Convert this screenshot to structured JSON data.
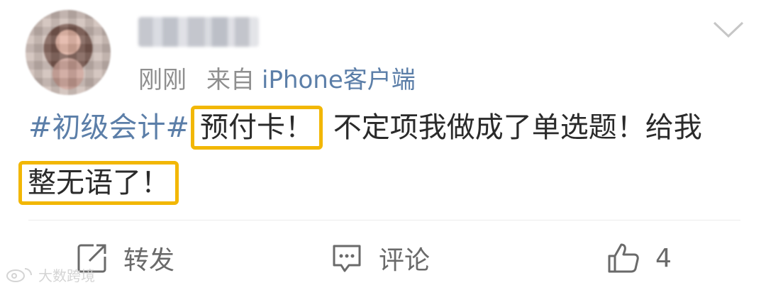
{
  "post": {
    "time": "刚刚",
    "source_prefix": "来自",
    "client": "iPhone客户端",
    "hashtag": "#初级会计#",
    "highlight_1": "预付卡！",
    "text_1": "不定项我做成了单选题！给我",
    "highlight_2": "整无语了！"
  },
  "actions": {
    "repost_label": "转发",
    "comment_label": "评论",
    "like_count": "4"
  },
  "watermark": "大数跨境",
  "icons": {
    "menu": "chevron-down-icon",
    "repost": "repost-icon",
    "comment": "comment-icon",
    "like": "thumbs-up-icon",
    "watermark": "weibo-logo-icon"
  },
  "colors": {
    "link": "#5b7ea8",
    "highlight_border": "#f2b705",
    "meta_text": "#8f8f8f"
  }
}
